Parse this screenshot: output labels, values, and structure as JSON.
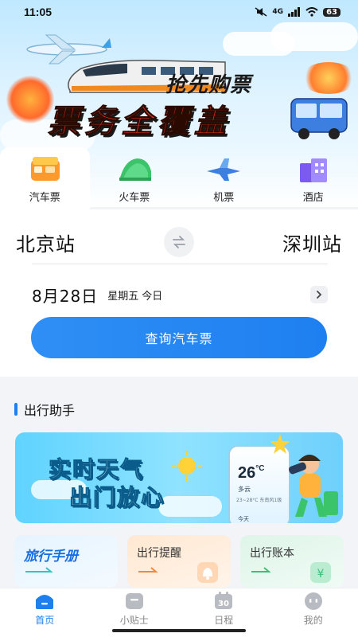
{
  "status_bar": {
    "time": "11:05",
    "network": "4G",
    "battery": "63"
  },
  "hero": {
    "subtitle": "抢先购票",
    "title": "票务全覆盖"
  },
  "tabs": [
    {
      "label": "汽车票",
      "icon": "bus-ticket-icon",
      "active": true
    },
    {
      "label": "火车票",
      "icon": "train-icon",
      "active": false
    },
    {
      "label": "机票",
      "icon": "plane-icon",
      "active": false
    },
    {
      "label": "酒店",
      "icon": "hotel-icon",
      "active": false
    }
  ],
  "search": {
    "from_station": "北京站",
    "to_station": "深圳站",
    "date": "8月28日",
    "weekday": "星期五",
    "today_label": "今日",
    "query_button": "查询汽车票"
  },
  "assistant": {
    "section_title": "出行助手",
    "weather_banner": {
      "line1": "实时天气",
      "line2": "出门放心",
      "temperature": "26",
      "unit": "°C",
      "condition": "多云",
      "details": "23~28°C 东南风1级",
      "today": "今天"
    },
    "cards": [
      {
        "title": "旅行手册"
      },
      {
        "title": "出行提醒"
      },
      {
        "title": "出行账本"
      }
    ]
  },
  "bottom_nav": [
    {
      "label": "首页",
      "icon": "home-icon",
      "active": true
    },
    {
      "label": "小贴士",
      "icon": "tips-icon",
      "active": false
    },
    {
      "label": "日程",
      "icon": "calendar-icon",
      "active": false,
      "icon_text": "30"
    },
    {
      "label": "我的",
      "icon": "profile-icon",
      "active": false
    }
  ],
  "colors": {
    "accent": "#1e7ff0",
    "hero_title": "#e8321e"
  }
}
